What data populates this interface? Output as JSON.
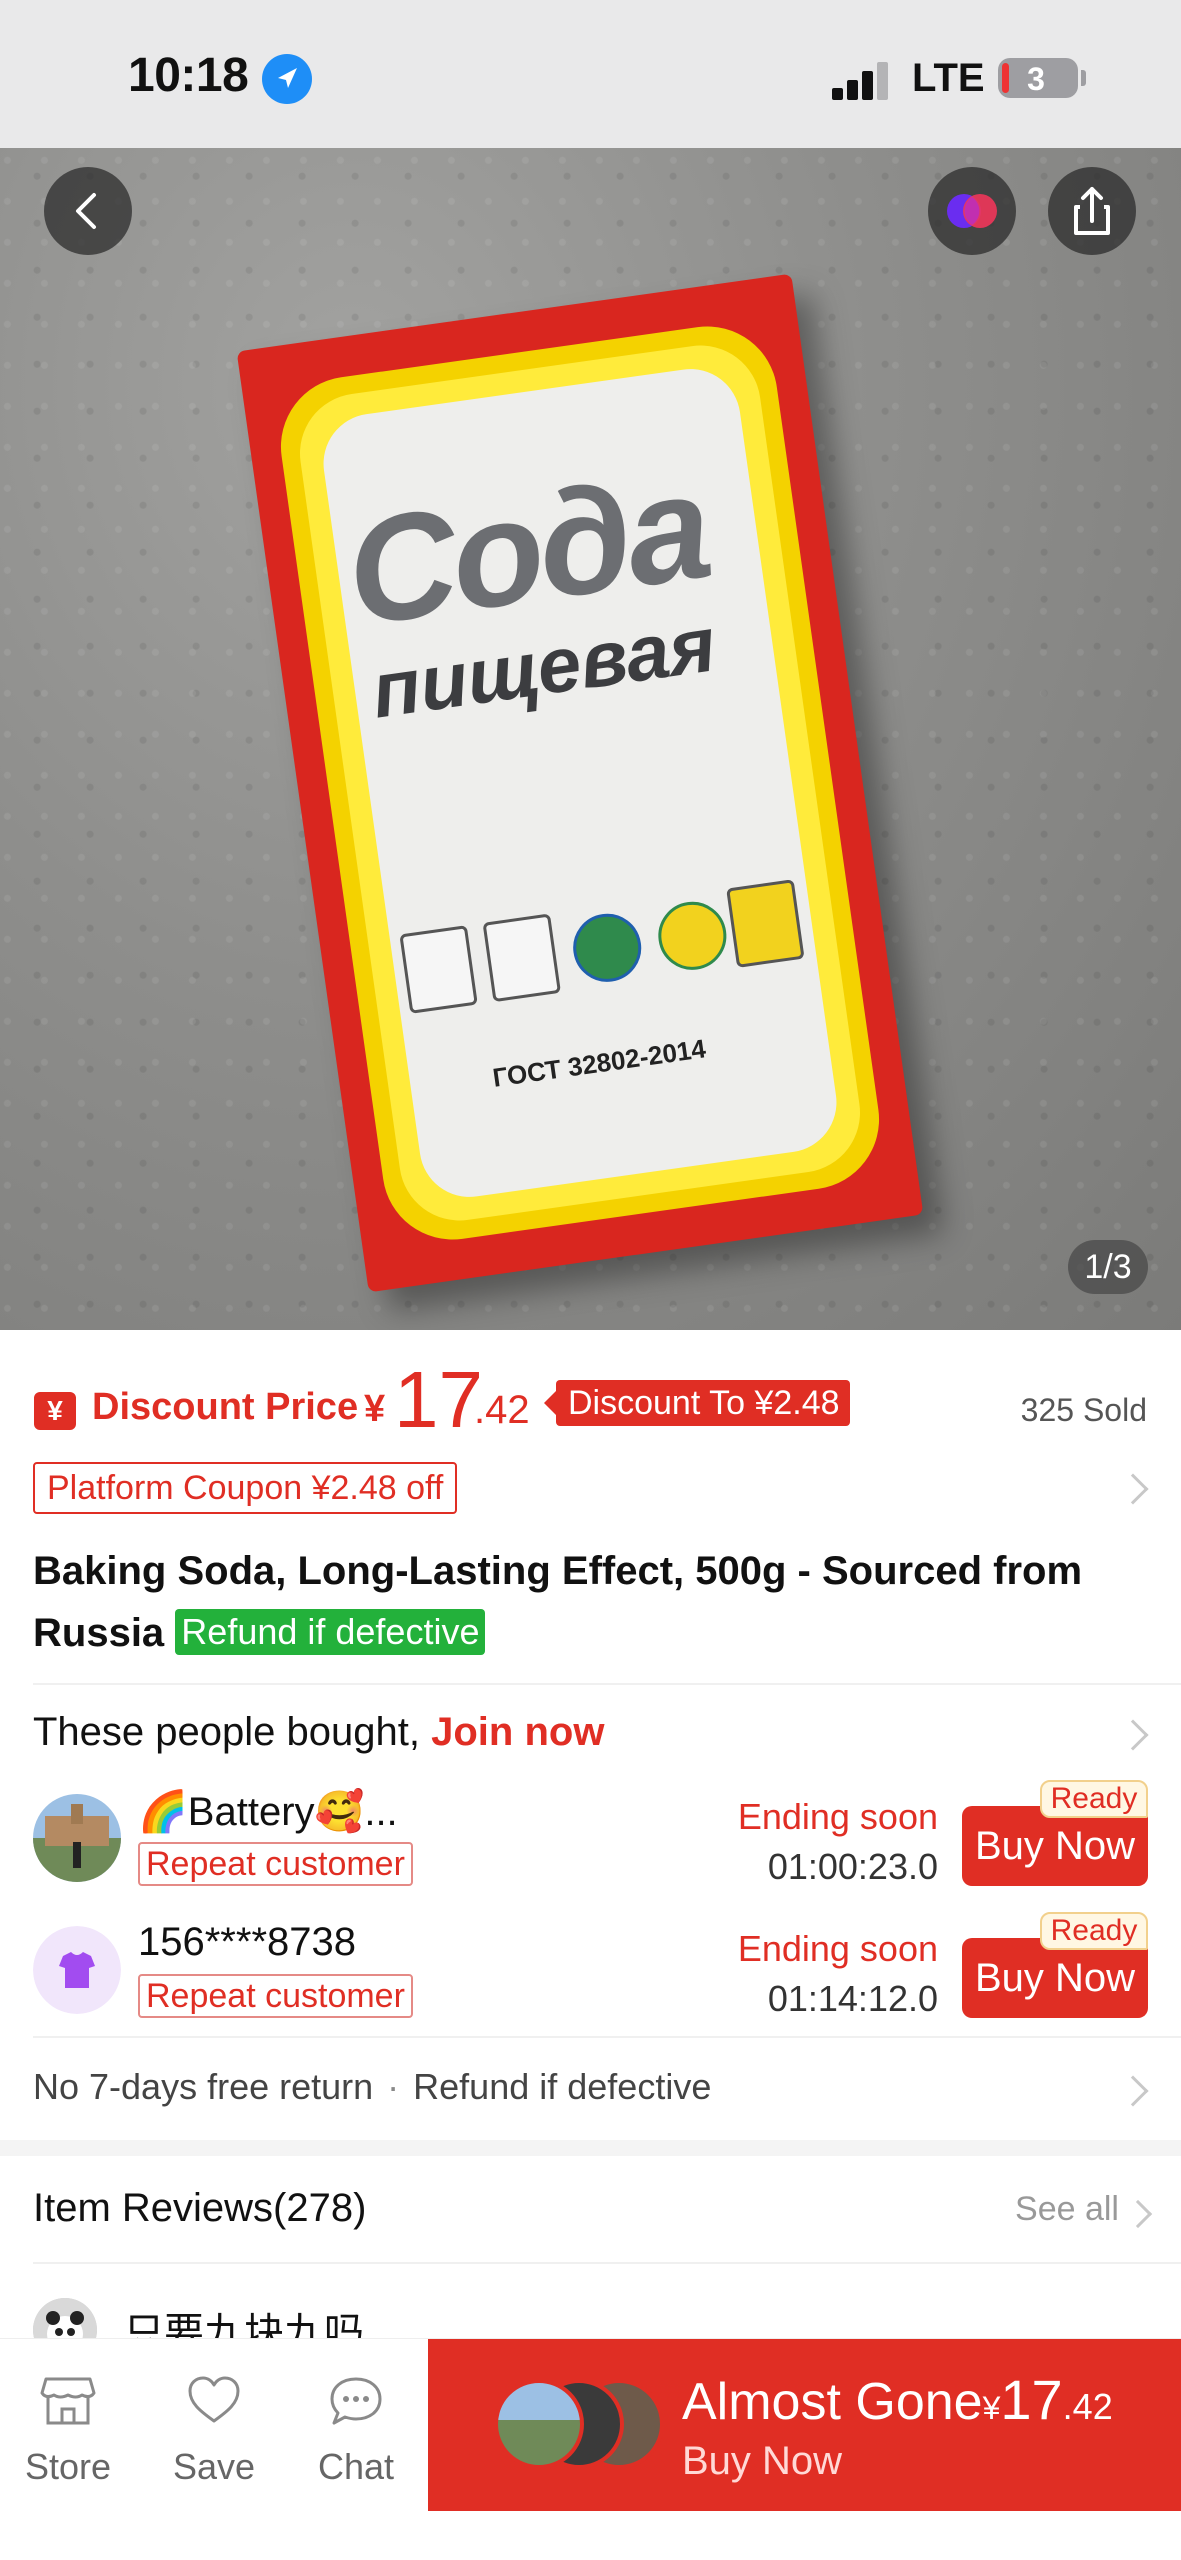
{
  "status_bar": {
    "time": "10:18",
    "network": "LTE",
    "battery_level": "3",
    "signal_bars": 3
  },
  "hero": {
    "box_title_line1": "Сода",
    "box_title_line2": "пищевая",
    "box_gost": "ГОСТ 32802-2014",
    "image_counter": "1/3"
  },
  "price": {
    "icon": "¥",
    "label": "Discount Price",
    "currency": "¥",
    "integer": "17",
    "decimal": ".42",
    "discount_badge": "Discount To ¥2.48",
    "sold": "325 Sold"
  },
  "coupon": {
    "label": "Platform Coupon ¥2.48 off"
  },
  "product": {
    "title": "Baking Soda, Long-Lasting Effect, 500g - Sourced from Russia",
    "refund_tag": "Refund if defective"
  },
  "group_buy": {
    "prefix": "These people bought,",
    "join": "Join now",
    "buyers": [
      {
        "name": "🌈Battery🥰...",
        "tag": "Repeat customer",
        "status": "Ending soon",
        "countdown": "01:00:23.0",
        "button": "Buy Now",
        "ready": "Ready"
      },
      {
        "name": "156****8738",
        "tag": "Repeat customer",
        "status": "Ending soon",
        "countdown": "01:14:12.0",
        "button": "Buy Now",
        "ready": "Ready"
      }
    ]
  },
  "returns": {
    "policy": "No 7-days free return",
    "separator": "·",
    "refund": "Refund if defective"
  },
  "reviews": {
    "title": "Item Reviews(278)",
    "see_all": "See all",
    "first_review_text": "只要九块九吗"
  },
  "bottom_bar": {
    "store": "Store",
    "save": "Save",
    "chat": "Chat",
    "almost_gone": "Almost Gone",
    "currency": "¥",
    "price_int": "17",
    "price_dec": ".42",
    "buy_now": "Buy Now"
  },
  "colors": {
    "accent": "#e02e24",
    "refund_green": "#23b13b",
    "status_bar_bg": "#e9e9ea"
  }
}
